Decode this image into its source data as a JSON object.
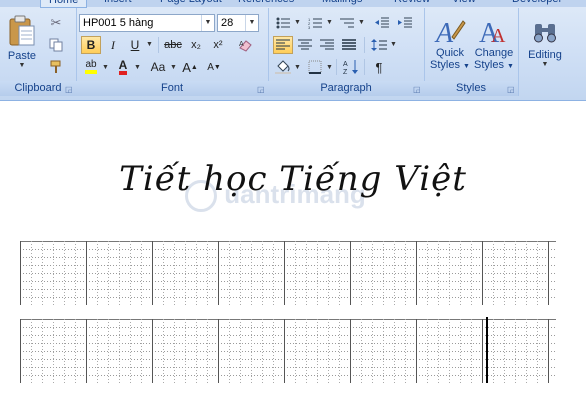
{
  "tabs": [
    "Home",
    "Insert",
    "Page Layout",
    "References",
    "Mailings",
    "Review",
    "View",
    "Developer"
  ],
  "clipboard": {
    "paste_label": "Paste",
    "group_label": "Clipboard"
  },
  "font": {
    "family": "HP001 5 hàng",
    "size": "28",
    "group_label": "Font",
    "bold": "B",
    "italic": "I",
    "underline": "U",
    "strike": "abc",
    "subscript": "x₂",
    "superscript": "x²",
    "change_case": "Aa",
    "grow": "A",
    "shrink": "A"
  },
  "paragraph": {
    "group_label": "Paragraph",
    "pilcrow": "¶"
  },
  "styles": {
    "quick_label_1": "Quick",
    "quick_label_2": "Styles",
    "change_label_1": "Change",
    "change_label_2": "Styles",
    "group_label": "Styles"
  },
  "editing": {
    "label": "Editing"
  },
  "document": {
    "title": "Tiết học Tiếng Việt",
    "watermark": "uantrimang"
  },
  "colors": {
    "highlight": "#ffff00",
    "font_color": "#e02020",
    "accent": "#15428b"
  }
}
